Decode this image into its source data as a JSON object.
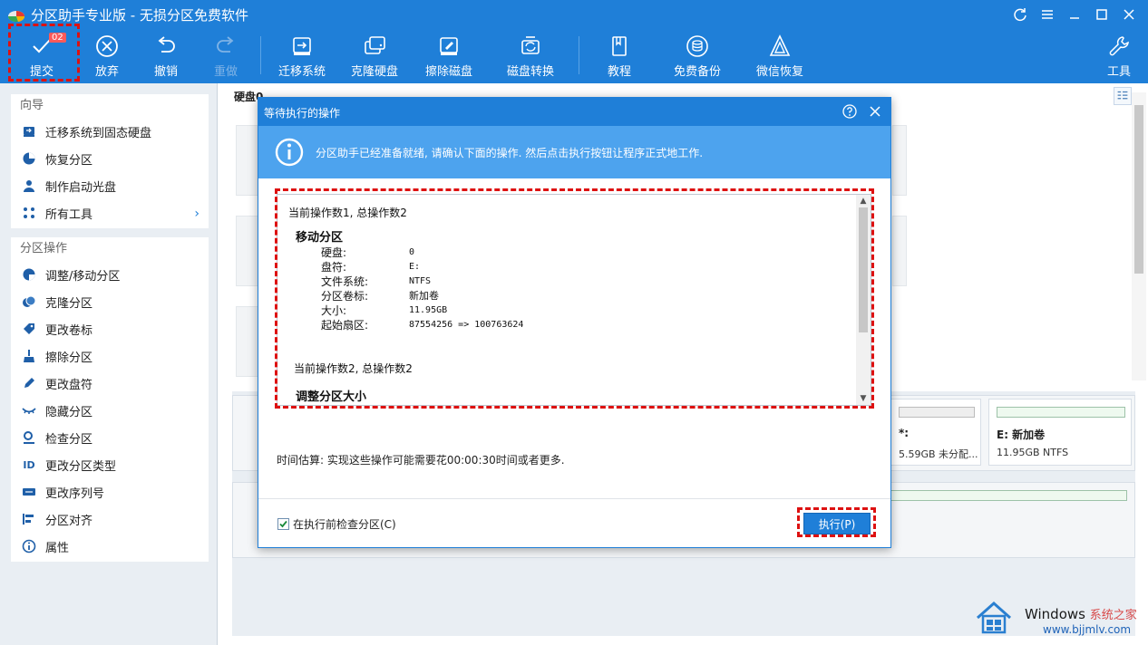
{
  "window": {
    "title": "分区助手专业版 - 无损分区免费软件"
  },
  "toolbar": {
    "submit_label": "提交",
    "submit_badge": "02",
    "discard_label": "放弃",
    "undo_label": "撤销",
    "redo_label": "重做",
    "migrate_label": "迁移系统",
    "clone_label": "克隆硬盘",
    "wipe_label": "擦除磁盘",
    "convert_label": "磁盘转换",
    "tutorial_label": "教程",
    "backup_label": "免费备份",
    "wechat_label": "微信恢复",
    "tools_label": "工具"
  },
  "sidebar": {
    "wizard_title": "向导",
    "wizard_items": [
      {
        "label": "迁移系统到固态硬盘",
        "icon": "ssd-icon"
      },
      {
        "label": "恢复分区",
        "icon": "pie-icon"
      },
      {
        "label": "制作启动光盘",
        "icon": "user-disk-icon"
      },
      {
        "label": "所有工具",
        "icon": "grid-icon"
      }
    ],
    "ops_title": "分区操作",
    "ops_items": [
      {
        "label": "调整/移动分区",
        "icon": "pie-resize-icon"
      },
      {
        "label": "克隆分区",
        "icon": "clone-icon"
      },
      {
        "label": "更改卷标",
        "icon": "tag-icon"
      },
      {
        "label": "擦除分区",
        "icon": "broom-icon"
      },
      {
        "label": "更改盘符",
        "icon": "pencil-icon"
      },
      {
        "label": "隐藏分区",
        "icon": "eye-hidden-icon"
      },
      {
        "label": "检查分区",
        "icon": "magnifier-icon"
      },
      {
        "label": "更改分区类型",
        "icon": "id-icon"
      },
      {
        "label": "更改序列号",
        "icon": "serial-icon"
      },
      {
        "label": "分区对齐",
        "icon": "align-icon"
      },
      {
        "label": "属性",
        "icon": "info-icon"
      }
    ]
  },
  "main": {
    "disk_heading": "硬盘0",
    "partitions": [
      {
        "name": "*:",
        "info": "5.59GB 未分配..."
      },
      {
        "name": "E: 新加卷",
        "info": "11.95GB NTFS"
      }
    ]
  },
  "dialog": {
    "title": "等待执行的操作",
    "banner_text": "分区助手已经准备就绪, 请确认下面的操作. 然后点击执行按钮让程序正式地工作.",
    "op1_counter": "当前操作数1, 总操作数2",
    "op1_title": "移动分区",
    "op1_fields": [
      {
        "key": "硬盘:",
        "value": "0"
      },
      {
        "key": "盘符:",
        "value": "E:"
      },
      {
        "key": "文件系统:",
        "value": "NTFS"
      },
      {
        "key": "分区卷标:",
        "value": "新加卷"
      },
      {
        "key": "大小:",
        "value": "11.95GB"
      },
      {
        "key": "起始扇区:",
        "value": "87554256 => 100763624"
      }
    ],
    "op2_counter": "当前操作数2, 总操作数2",
    "op2_title": "调整分区大小",
    "time_estimate": "时间估算: 实现这些操作可能需要花00:00:30时间或者更多.",
    "check_label": "在执行前检查分区(C)",
    "check_checked": true,
    "execute_label": "执行(P)"
  },
  "watermark": {
    "brand": "Windows",
    "brand_zh": "系统之家",
    "url": "www.bjjmlv.com"
  },
  "colors": {
    "accent": "#1f7fd8",
    "banner": "#4da3ee",
    "highlight": "#dd1111"
  }
}
